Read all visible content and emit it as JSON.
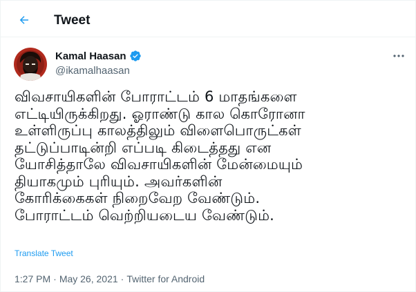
{
  "header": {
    "title": "Tweet",
    "back_icon": "arrow-left-icon"
  },
  "colors": {
    "accent": "#1d9bf0",
    "text_primary": "#0f1419",
    "text_secondary": "#536471",
    "border": "#eff3f4"
  },
  "author": {
    "display_name": "Kamal Haasan",
    "verified": true,
    "handle": "@ikamalhaasan"
  },
  "tweet": {
    "lines": [
      "விவசாயிகளின் போராட்டம் 6 மாதங்களை",
      "எட்டியிருக்கிறது. ஓராண்டு கால கொரோனா",
      "உள்ளிருப்பு காலத்திலும் விளைபொருட்கள்",
      "தட்டுப்பாடின்றி எப்படி கிடைத்தது என",
      "யோசித்தாலே விவசாயிகளின் மேன்மையும்",
      "தியாகமும் புரியும். அவர்களின்",
      "கோரிக்கைகள் நிறைவேற வேண்டும்.",
      "போராட்டம் வெற்றியடைய வேண்டும்."
    ],
    "translate_label": "Translate Tweet"
  },
  "meta": {
    "time": "1:27 PM",
    "separator": "·",
    "date": "May 26, 2021",
    "source": "Twitter for Android"
  }
}
